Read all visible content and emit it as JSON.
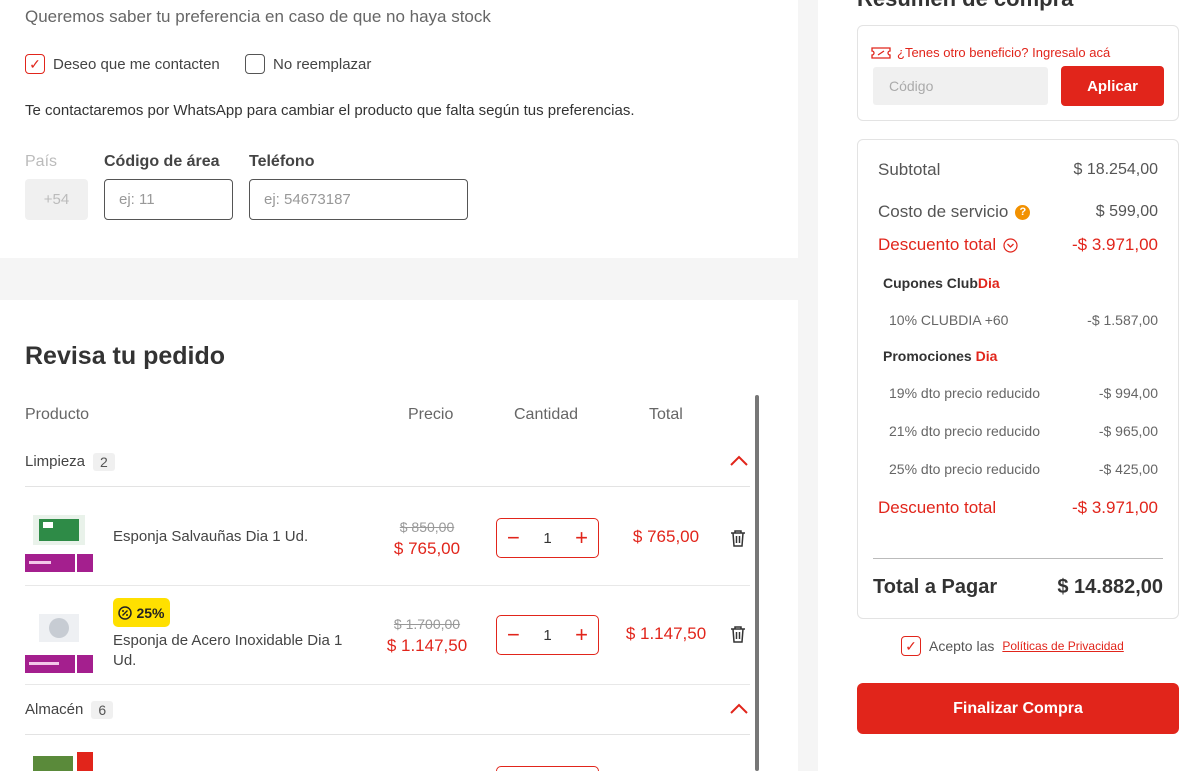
{
  "preferences": {
    "question": "Queremos saber tu preferencia en caso de que no haya stock",
    "option_contact": {
      "label": "Deseo que me contacten",
      "checked": true
    },
    "option_no_replace": {
      "label": "No reemplazar",
      "checked": false
    },
    "note": "Te contactaremos por WhatsApp para cambiar el producto que falta según tus preferencias."
  },
  "phone_form": {
    "country_label": "País",
    "country_value": "+54",
    "area_label": "Código de área",
    "area_placeholder": "ej: 11",
    "phone_label": "Teléfono",
    "phone_placeholder": "ej: 54673187"
  },
  "order": {
    "title": "Revisa tu pedido",
    "columns": [
      "Producto",
      "Precio",
      "Cantidad",
      "Total"
    ],
    "categories": [
      {
        "name": "Limpieza",
        "count": "2",
        "products": [
          {
            "name": "Esponja Salvauñas Dia 1 Ud.",
            "old_price": "$ 850,00",
            "price": "$ 765,00",
            "quantity": "1",
            "total": "$ 765,00",
            "badge": ""
          },
          {
            "name": "Esponja de Acero Inoxidable Dia 1 Ud.",
            "old_price": "$ 1.700,00",
            "price": "$ 1.147,50",
            "quantity": "1",
            "total": "$ 1.147,50",
            "badge": "25%"
          }
        ]
      },
      {
        "name": "Almacén",
        "count": "6"
      }
    ]
  },
  "summary": {
    "title": "Resumen de compra",
    "promo_hint": "¿Tenes otro beneficio? Ingresalo acá",
    "code_placeholder": "Código",
    "apply_label": "Aplicar",
    "subtotal_label": "Subtotal",
    "subtotal_value": "$ 18.254,00",
    "service_label": "Costo de servicio",
    "service_value": "$ 599,00",
    "discount_label": "Descuento total",
    "discount_value": "-$ 3.971,00",
    "coupons_heading": "Cupones Club",
    "coupons_brand": "Dia",
    "coupon_items": [
      {
        "label": "10% CLUBDIA +60",
        "value": "-$ 1.587,00"
      }
    ],
    "promos_heading": "Promociones ",
    "promos_brand": "Dia",
    "promo_items": [
      {
        "label": "19% dto precio reducido",
        "value": "-$ 994,00"
      },
      {
        "label": "21% dto precio reducido",
        "value": "-$ 965,00"
      },
      {
        "label": "25% dto precio reducido",
        "value": "-$ 425,00"
      }
    ],
    "discount_total_label": "Descuento total",
    "discount_total_value": "-$ 3.971,00",
    "total_label": "Total a Pagar",
    "total_value": "$ 14.882,00"
  },
  "terms": {
    "prefix": "Acepto las",
    "link": "Políticas de Privacidad",
    "checked": true
  },
  "finalize_label": "Finalizar Compra",
  "colors": {
    "brand_red": "#e1251b",
    "badge_yellow": "#ffe000",
    "info_orange": "#f29100"
  },
  "icons": [
    "checkbox-check-icon",
    "chevron-up-icon",
    "minus-icon",
    "plus-icon",
    "trash-icon",
    "discount-badge-icon",
    "ticket-icon",
    "info-icon",
    "chevron-down-circle-icon"
  ]
}
